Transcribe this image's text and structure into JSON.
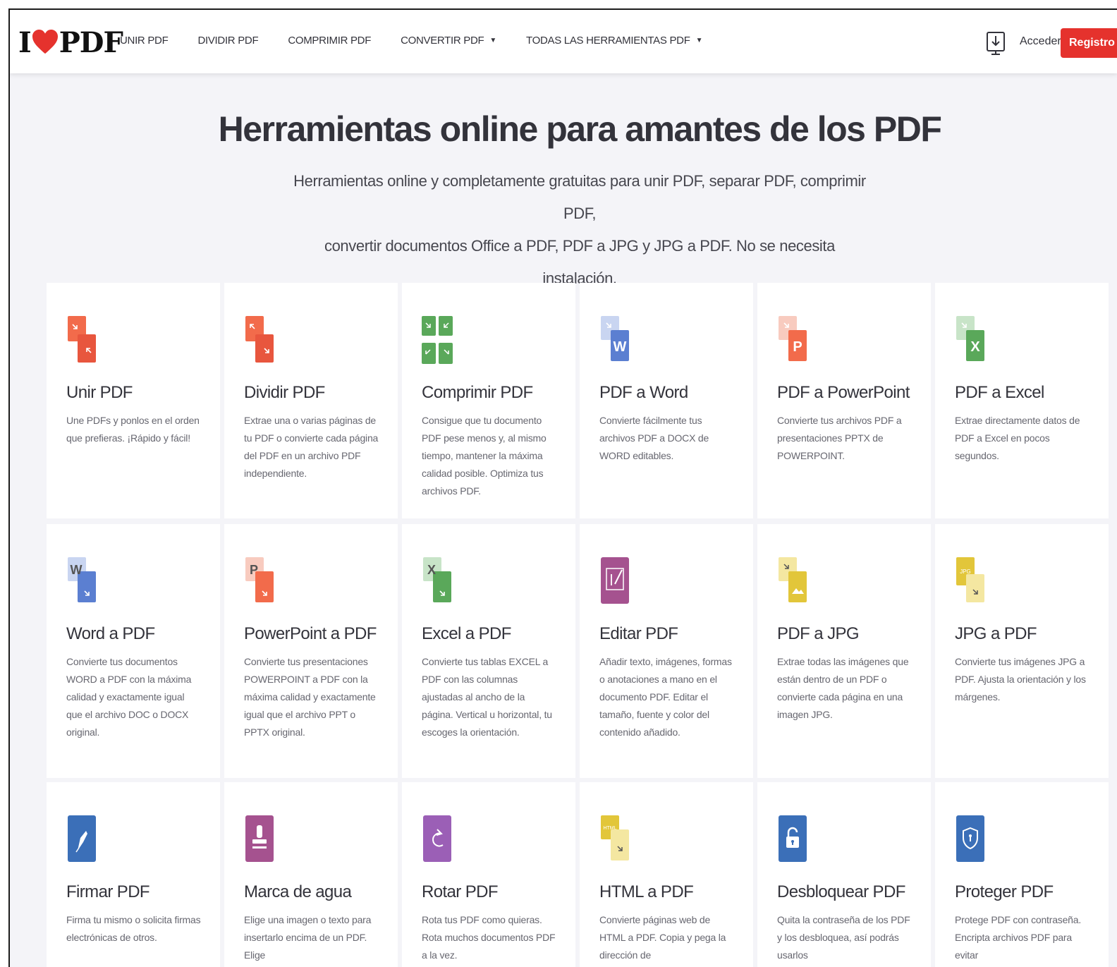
{
  "header": {
    "logo_left": "I",
    "logo_right": "PDF",
    "nav": [
      {
        "label": "UNIR PDF",
        "caret": false
      },
      {
        "label": "DIVIDIR PDF",
        "caret": false
      },
      {
        "label": "COMPRIMIR PDF",
        "caret": false
      },
      {
        "label": "CONVERTIR PDF",
        "caret": true
      },
      {
        "label": "TODAS LAS HERRAMIENTAS PDF",
        "caret": true
      }
    ],
    "caret_glyph": "▼",
    "login_label": "Acceder",
    "register_label": "Registro"
  },
  "hero": {
    "title": "Herramientas online para amantes de los PDF",
    "subtitle_line1": "Herramientas online y completamente gratuitas para unir PDF, separar PDF, comprimir PDF,",
    "subtitle_line2": "convertir documentos Office a PDF, PDF a JPG y JPG a PDF. No se necesita instalación."
  },
  "colors": {
    "brand_red": "#e5322d",
    "word_blue": "#5b7fd1",
    "ppt_orange": "#f26b4b",
    "excel_green": "#5aa85a",
    "edit_purple": "#a5528f",
    "jpg_yellow": "#e2c63a",
    "sign_blue": "#3b6fb8",
    "rotate_purple": "#9b5fb6"
  },
  "tools": [
    {
      "title": "Unir PDF",
      "desc": "Une PDFs y ponlos en el orden que prefieras. ¡Rápido y fácil!",
      "icon": "merge-icon"
    },
    {
      "title": "Dividir PDF",
      "desc": "Extrae una o varias páginas de tu PDF o convierte cada página del PDF en un archivo PDF independiente.",
      "icon": "split-icon"
    },
    {
      "title": "Comprimir PDF",
      "desc": "Consigue que tu documento PDF pese menos y, al mismo tiempo, mantener la máxima calidad posible. Optimiza tus archivos PDF.",
      "icon": "compress-icon"
    },
    {
      "title": "PDF a Word",
      "desc": "Convierte fácilmente tus archivos PDF a DOCX de WORD editables.",
      "icon": "pdf-to-word-icon",
      "letter": "W"
    },
    {
      "title": "PDF a PowerPoint",
      "desc": "Convierte tus archivos PDF a presentaciones PPTX de POWERPOINT.",
      "icon": "pdf-to-powerpoint-icon",
      "letter": "P"
    },
    {
      "title": "PDF a Excel",
      "desc": "Extrae directamente datos de PDF a Excel en pocos segundos.",
      "icon": "pdf-to-excel-icon",
      "letter": "X"
    },
    {
      "title": "Word a PDF",
      "desc": "Convierte tus documentos WORD a PDF con la máxima calidad y exactamente igual que el archivo DOC o DOCX original.",
      "icon": "word-to-pdf-icon",
      "letter": "W"
    },
    {
      "title": "PowerPoint a PDF",
      "desc": "Convierte tus presentaciones POWERPOINT a PDF con la máxima calidad y exactamente igual que el archivo PPT o PPTX original.",
      "icon": "powerpoint-to-pdf-icon",
      "letter": "P"
    },
    {
      "title": "Excel a PDF",
      "desc": "Convierte tus tablas EXCEL a PDF con las columnas ajustadas al ancho de la página. Vertical u horizontal, tu escoges la orientación.",
      "icon": "excel-to-pdf-icon",
      "letter": "X"
    },
    {
      "title": "Editar PDF",
      "desc": "Añadir texto, imágenes, formas o anotaciones a mano en el documento PDF. Editar el tamaño, fuente y color del contenido añadido.",
      "icon": "edit-pdf-icon"
    },
    {
      "title": "PDF a JPG",
      "desc": "Extrae todas las imágenes que están dentro de un PDF o convierte cada página en una imagen JPG.",
      "icon": "pdf-to-jpg-icon"
    },
    {
      "title": "JPG a PDF",
      "desc": "Convierte tus imágenes JPG a PDF. Ajusta la orientación y los márgenes.",
      "icon": "jpg-to-pdf-icon",
      "letter": "JPG"
    },
    {
      "title": "Firmar PDF",
      "desc": "Firma tu mismo o solicita firmas electrónicas de otros.",
      "icon": "sign-pdf-icon"
    },
    {
      "title": "Marca de agua",
      "desc": "Elige una imagen o texto para insertarlo encima de un PDF. Elige",
      "icon": "watermark-icon"
    },
    {
      "title": "Rotar PDF",
      "desc": "Rota tus PDF como quieras. Rota muchos documentos PDF a la vez.",
      "icon": "rotate-pdf-icon"
    },
    {
      "title": "HTML a PDF",
      "desc": "Convierte páginas web de HTML a PDF. Copia y pega la dirección de",
      "icon": "html-to-pdf-icon",
      "letter": "HTML"
    },
    {
      "title": "Desbloquear PDF",
      "desc": "Quita la contraseña de los PDF y los desbloquea, así podrás usarlos",
      "icon": "unlock-pdf-icon"
    },
    {
      "title": "Proteger PDF",
      "desc": "Protege PDF con contraseña. Encripta archivos PDF para evitar",
      "icon": "protect-pdf-icon"
    }
  ]
}
